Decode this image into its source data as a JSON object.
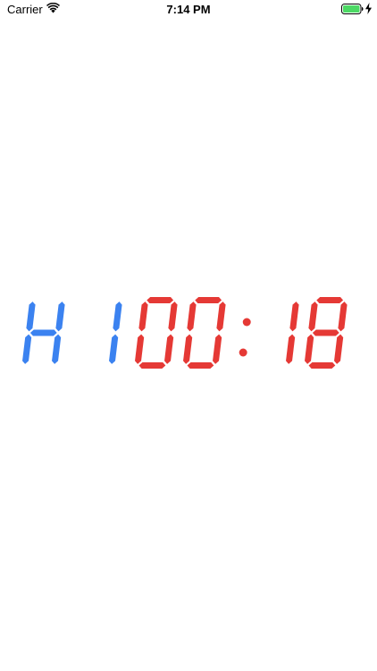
{
  "status_bar": {
    "carrier": "Carrier",
    "time": "7:14 PM",
    "wifi_icon": "wifi-icon",
    "battery_icon": "battery-full-icon",
    "charging_icon": "charging-bolt-icon",
    "battery_color": "#4cd964"
  },
  "scoreboard": {
    "half_label": "H",
    "half_number": "1",
    "minutes": "00",
    "seconds": "18",
    "half_color": "#3b82f0",
    "clock_color": "#e53935"
  }
}
